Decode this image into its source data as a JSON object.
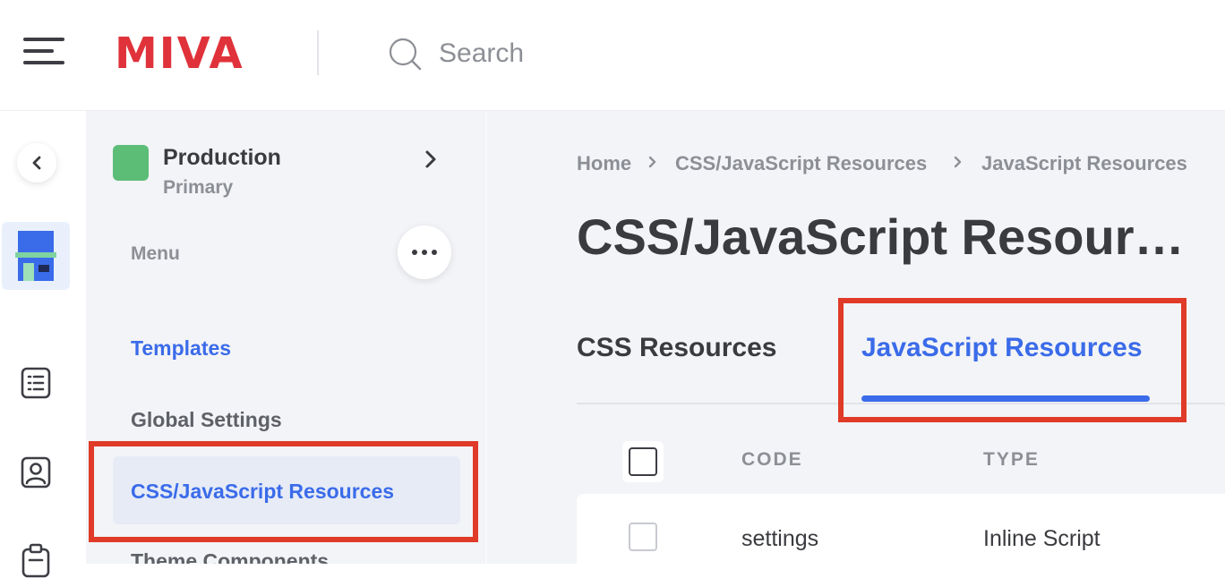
{
  "brand": {
    "logo_text": "MIVA",
    "accent": "#e0323a"
  },
  "search": {
    "placeholder": "Search"
  },
  "store": {
    "name": "Production",
    "subtitle": "Primary",
    "swatch_color": "#5cbd77"
  },
  "sidebar": {
    "menu_label": "Menu",
    "items": [
      {
        "label": "Templates",
        "state": "link"
      },
      {
        "label": "Global Settings",
        "state": "normal"
      },
      {
        "label": "CSS/JavaScript Resources",
        "state": "active"
      },
      {
        "label": "Theme Components",
        "state": "normal"
      }
    ]
  },
  "breadcrumb": [
    "Home",
    "CSS/JavaScript Resources",
    "JavaScript Resources"
  ],
  "page": {
    "title": "CSS/JavaScript Resources"
  },
  "tabs": [
    {
      "label": "CSS Resources",
      "active": false
    },
    {
      "label": "JavaScript Resources",
      "active": true
    }
  ],
  "table": {
    "columns": [
      "CODE",
      "TYPE"
    ],
    "rows": [
      {
        "code": "settings",
        "type": "Inline Script"
      }
    ]
  },
  "colors": {
    "link_blue": "#3a6be9",
    "highlight_red": "#e03a28"
  }
}
